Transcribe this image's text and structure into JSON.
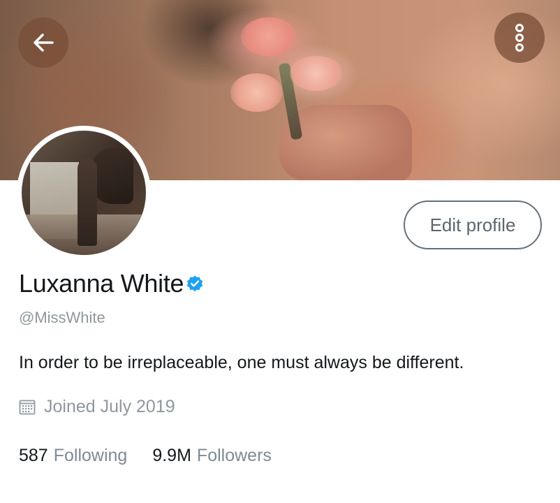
{
  "header": {
    "back_icon": "arrow-left-icon",
    "more_icon": "more-vertical-icon"
  },
  "profile": {
    "display_name": "Luxanna White",
    "verified_icon": "verified-badge-icon",
    "verified_color": "#1da1f2",
    "handle": "@MissWhite",
    "bio": "In order to be irreplaceable, one must always be different.",
    "joined_icon": "calendar-icon",
    "joined": "Joined July 2019",
    "edit_button_label": "Edit profile"
  },
  "stats": {
    "following_count": "587",
    "following_label": "Following",
    "followers_count": "9.9M",
    "followers_label": "Followers"
  }
}
